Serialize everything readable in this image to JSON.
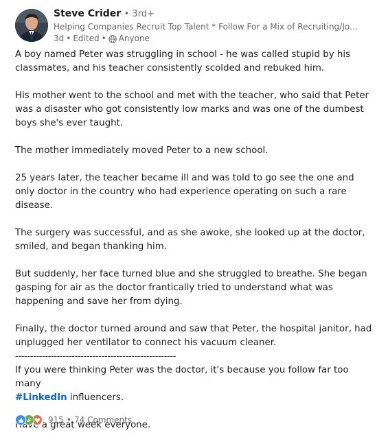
{
  "author": {
    "name": "Steve Crider",
    "degree": "• 3rd+",
    "headline": "Helping Companies Recruit Top Talent * Follow For a Mix of Recruiting/Job Seeki...",
    "time": "3d",
    "edited": "Edited",
    "visibility": "Anyone"
  },
  "post": {
    "paragraphs": [
      "A boy named Peter was struggling in school - he was called stupid by his classmates, and his teacher consistently scolded and rebuked him.",
      "His mother went to the school and met with the teacher, who said that Peter was a disaster who got consistently low marks and was one of the dumbest boys she's ever taught.",
      "The mother immediately moved Peter to a new school.",
      "25 years later, the teacher became ill and was told to go see the one and only doctor in the country who had experience operating on such a rare disease.",
      "The surgery was successful, and as she awoke, she looked up at the doctor, smiled, and began thanking him.",
      "But suddenly, her face turned blue and she struggled to breathe.  She began gasping for air as the doctor frantically tried to understand what was happening and save her from dying.",
      "Finally, the doctor turned around and saw that Peter, the hospital janitor, had unplugged her ventilator to connect his vacuum cleaner."
    ],
    "divider": "------------------------------------------------------",
    "closing_before_tag": "If you were thinking Peter was the doctor, it's because you follow far too many",
    "hashtag": "#LinkedIn",
    "closing_after_tag": " influencers.",
    "signoff": "Have a great week everyone."
  },
  "reactions": {
    "count": "915",
    "separator": "•",
    "comments": "74 Comments",
    "icons": [
      "like-icon",
      "celebrate-icon",
      "love-icon"
    ],
    "colors": {
      "like": "#378fe9",
      "celebrate": "#6dae4f",
      "love": "#df704d"
    }
  },
  "colors": {
    "hashtag": "#0a66c2",
    "secondary_text": "#666666"
  }
}
